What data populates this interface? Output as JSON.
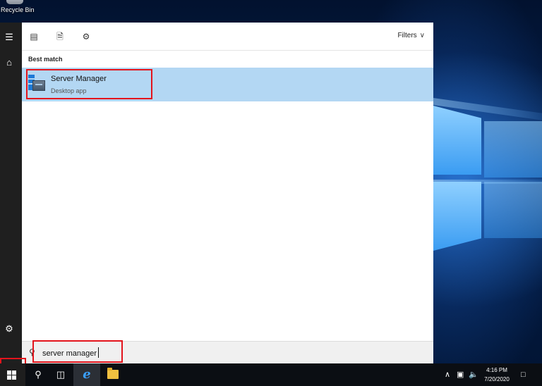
{
  "desktop": {
    "recycle_bin_label": "Recycle Bin"
  },
  "left_rail": {
    "icons": [
      "hamburger-menu-icon",
      "home-icon",
      "settings-icon"
    ]
  },
  "toolbar": {
    "icons": [
      "apps-filter-icon",
      "documents-filter-icon",
      "settings-filter-icon"
    ],
    "filters_label": "Filters"
  },
  "results": {
    "section_label": "Best match",
    "best_match": {
      "title": "Server Manager",
      "subtitle": "Desktop app"
    }
  },
  "search": {
    "query": "server manager"
  },
  "taskbar": {
    "time": "4:16 PM",
    "date": "7/20/2020"
  },
  "colors": {
    "highlight": "#e3141c",
    "selected_row": "#b3d7f3",
    "taskbar": "#0b0e13"
  }
}
